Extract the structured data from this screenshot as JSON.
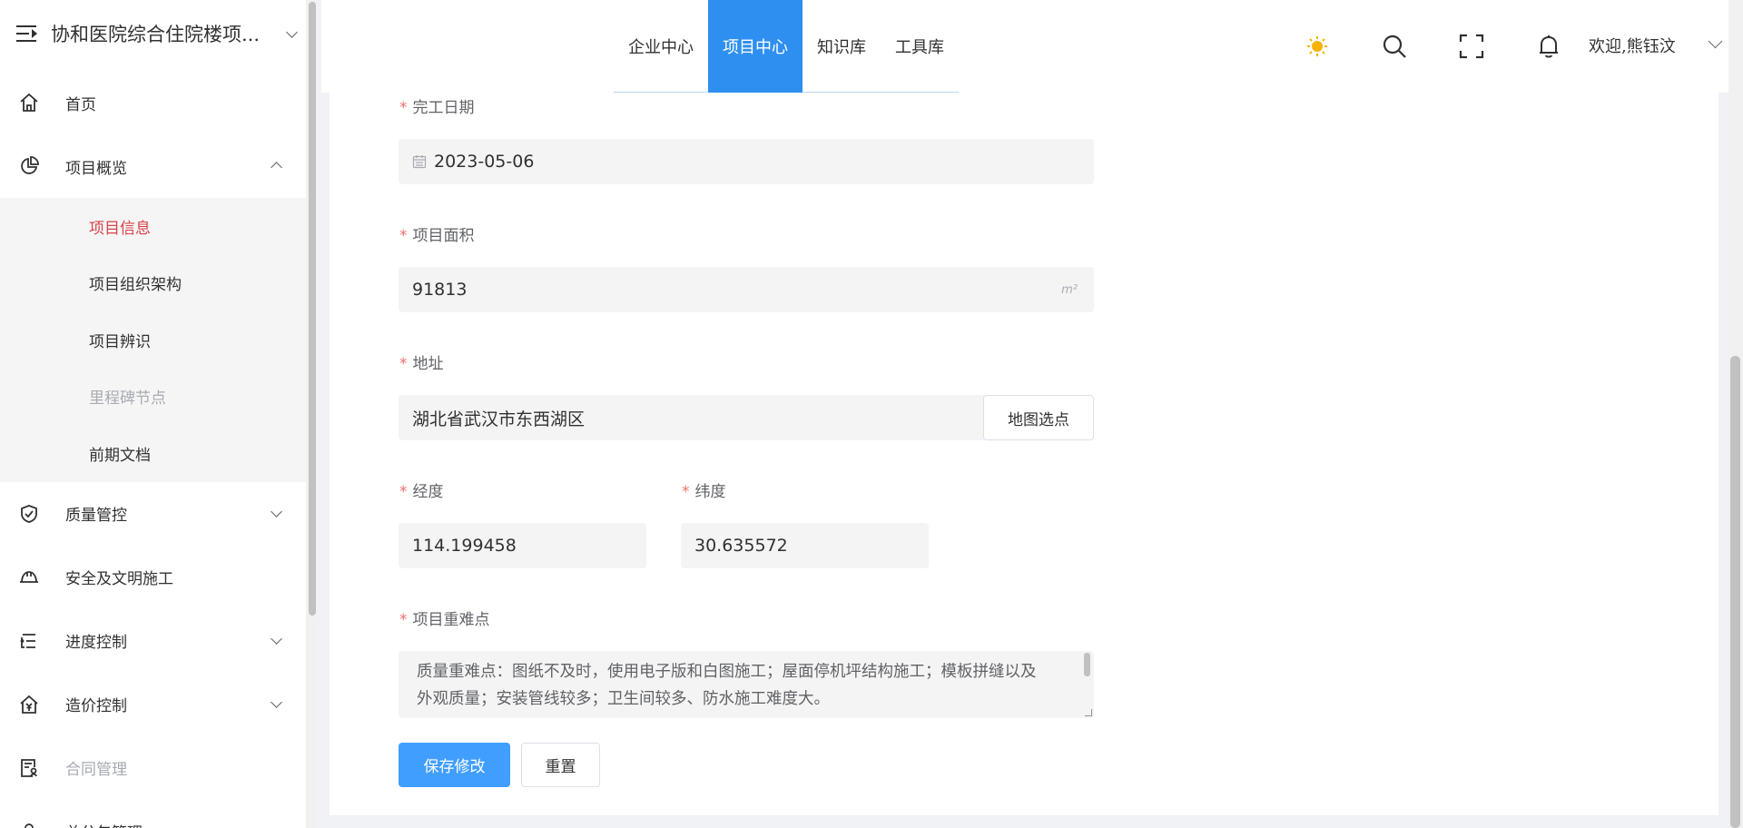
{
  "sidebar": {
    "project_title": "协和医院综合住院楼项...",
    "items": [
      {
        "label": "首页"
      },
      {
        "label": "项目概览"
      },
      {
        "label": "质量管控"
      },
      {
        "label": "安全及文明施工"
      },
      {
        "label": "进度控制"
      },
      {
        "label": "造价控制"
      },
      {
        "label": "合同管理"
      },
      {
        "label": "总分包管理"
      }
    ],
    "submenu": [
      {
        "label": "项目信息"
      },
      {
        "label": "项目组织架构"
      },
      {
        "label": "项目辨识"
      },
      {
        "label": "里程碑节点"
      },
      {
        "label": "前期文档"
      }
    ]
  },
  "header": {
    "tabs": [
      {
        "label": "企业中心"
      },
      {
        "label": "项目中心"
      },
      {
        "label": "知识库"
      },
      {
        "label": "工具库"
      }
    ],
    "welcome": "欢迎,熊钰汶",
    "icons": [
      "theme-sun-icon",
      "search-icon",
      "fullscreen-icon",
      "bell-icon",
      "chevron-down-icon"
    ],
    "accent": "#2f8ff0"
  },
  "form": {
    "completion_date": {
      "label": "完工日期",
      "value": "2023-05-06"
    },
    "area": {
      "label": "项目面积",
      "value": "91813",
      "unit": "m²"
    },
    "address": {
      "label": "地址",
      "value": "湖北省武汉市东西湖区",
      "map_button": "地图选点"
    },
    "longitude": {
      "label": "经度",
      "value": "114.199458"
    },
    "latitude": {
      "label": "纬度",
      "value": "30.635572"
    },
    "difficulties": {
      "label": "项目重难点",
      "value": "质量重难点：图纸不及时，使用电子版和白图施工；屋面停机坪结构施工；模板拼缝以及外观质量；安装管线较多；卫生间较多、防水施工难度大。"
    },
    "required_mark": "*",
    "save_button": "保存修改",
    "reset_button": "重置"
  },
  "colors": {
    "primary": "#409eff",
    "required": "#f56c6c",
    "active_menu": "#d9434a"
  }
}
